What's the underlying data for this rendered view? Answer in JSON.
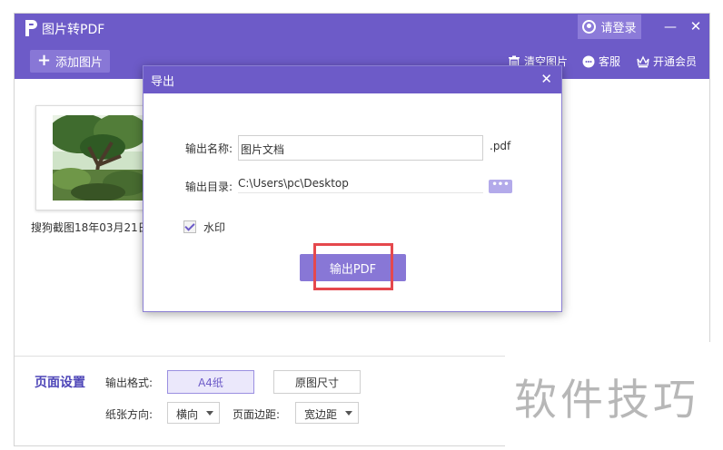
{
  "app": {
    "title": "图片转PDF",
    "login_label": "请登录",
    "minimize_glyph": "—",
    "close_glyph": "✕",
    "accent_color": "#6d5bc8"
  },
  "toolbar": {
    "add_image_label": "添加图片",
    "clear_label": "清空图片",
    "service_label": "客服",
    "vip_label": "开通会员",
    "icons": [
      "trash-icon",
      "chat-icon",
      "crown-icon"
    ]
  },
  "file_list": {
    "items": [
      {
        "caption": "搜狗截图18年03月21日"
      }
    ]
  },
  "page_settings": {
    "title": "页面设置",
    "format_label": "输出格式:",
    "format_options": [
      "A4纸",
      "原图尺寸"
    ],
    "selected_format": "A4纸",
    "direction_label": "纸张方向:",
    "direction_value": "横向",
    "margin_label": "页面边距:",
    "margin_value": "宽边距"
  },
  "export_dialog": {
    "title": "导出",
    "name_label": "输出名称:",
    "name_value": "图片文档",
    "extension": ".pdf",
    "dir_label": "输出目录:",
    "dir_value": "C:\\Users\\pc\\Desktop",
    "browse_label": "•••",
    "watermark_label": "水印",
    "watermark_checked": true,
    "export_button_label": "输出PDF",
    "close_glyph": "✕"
  },
  "overlay": {
    "watermark_text": "软件技巧"
  }
}
